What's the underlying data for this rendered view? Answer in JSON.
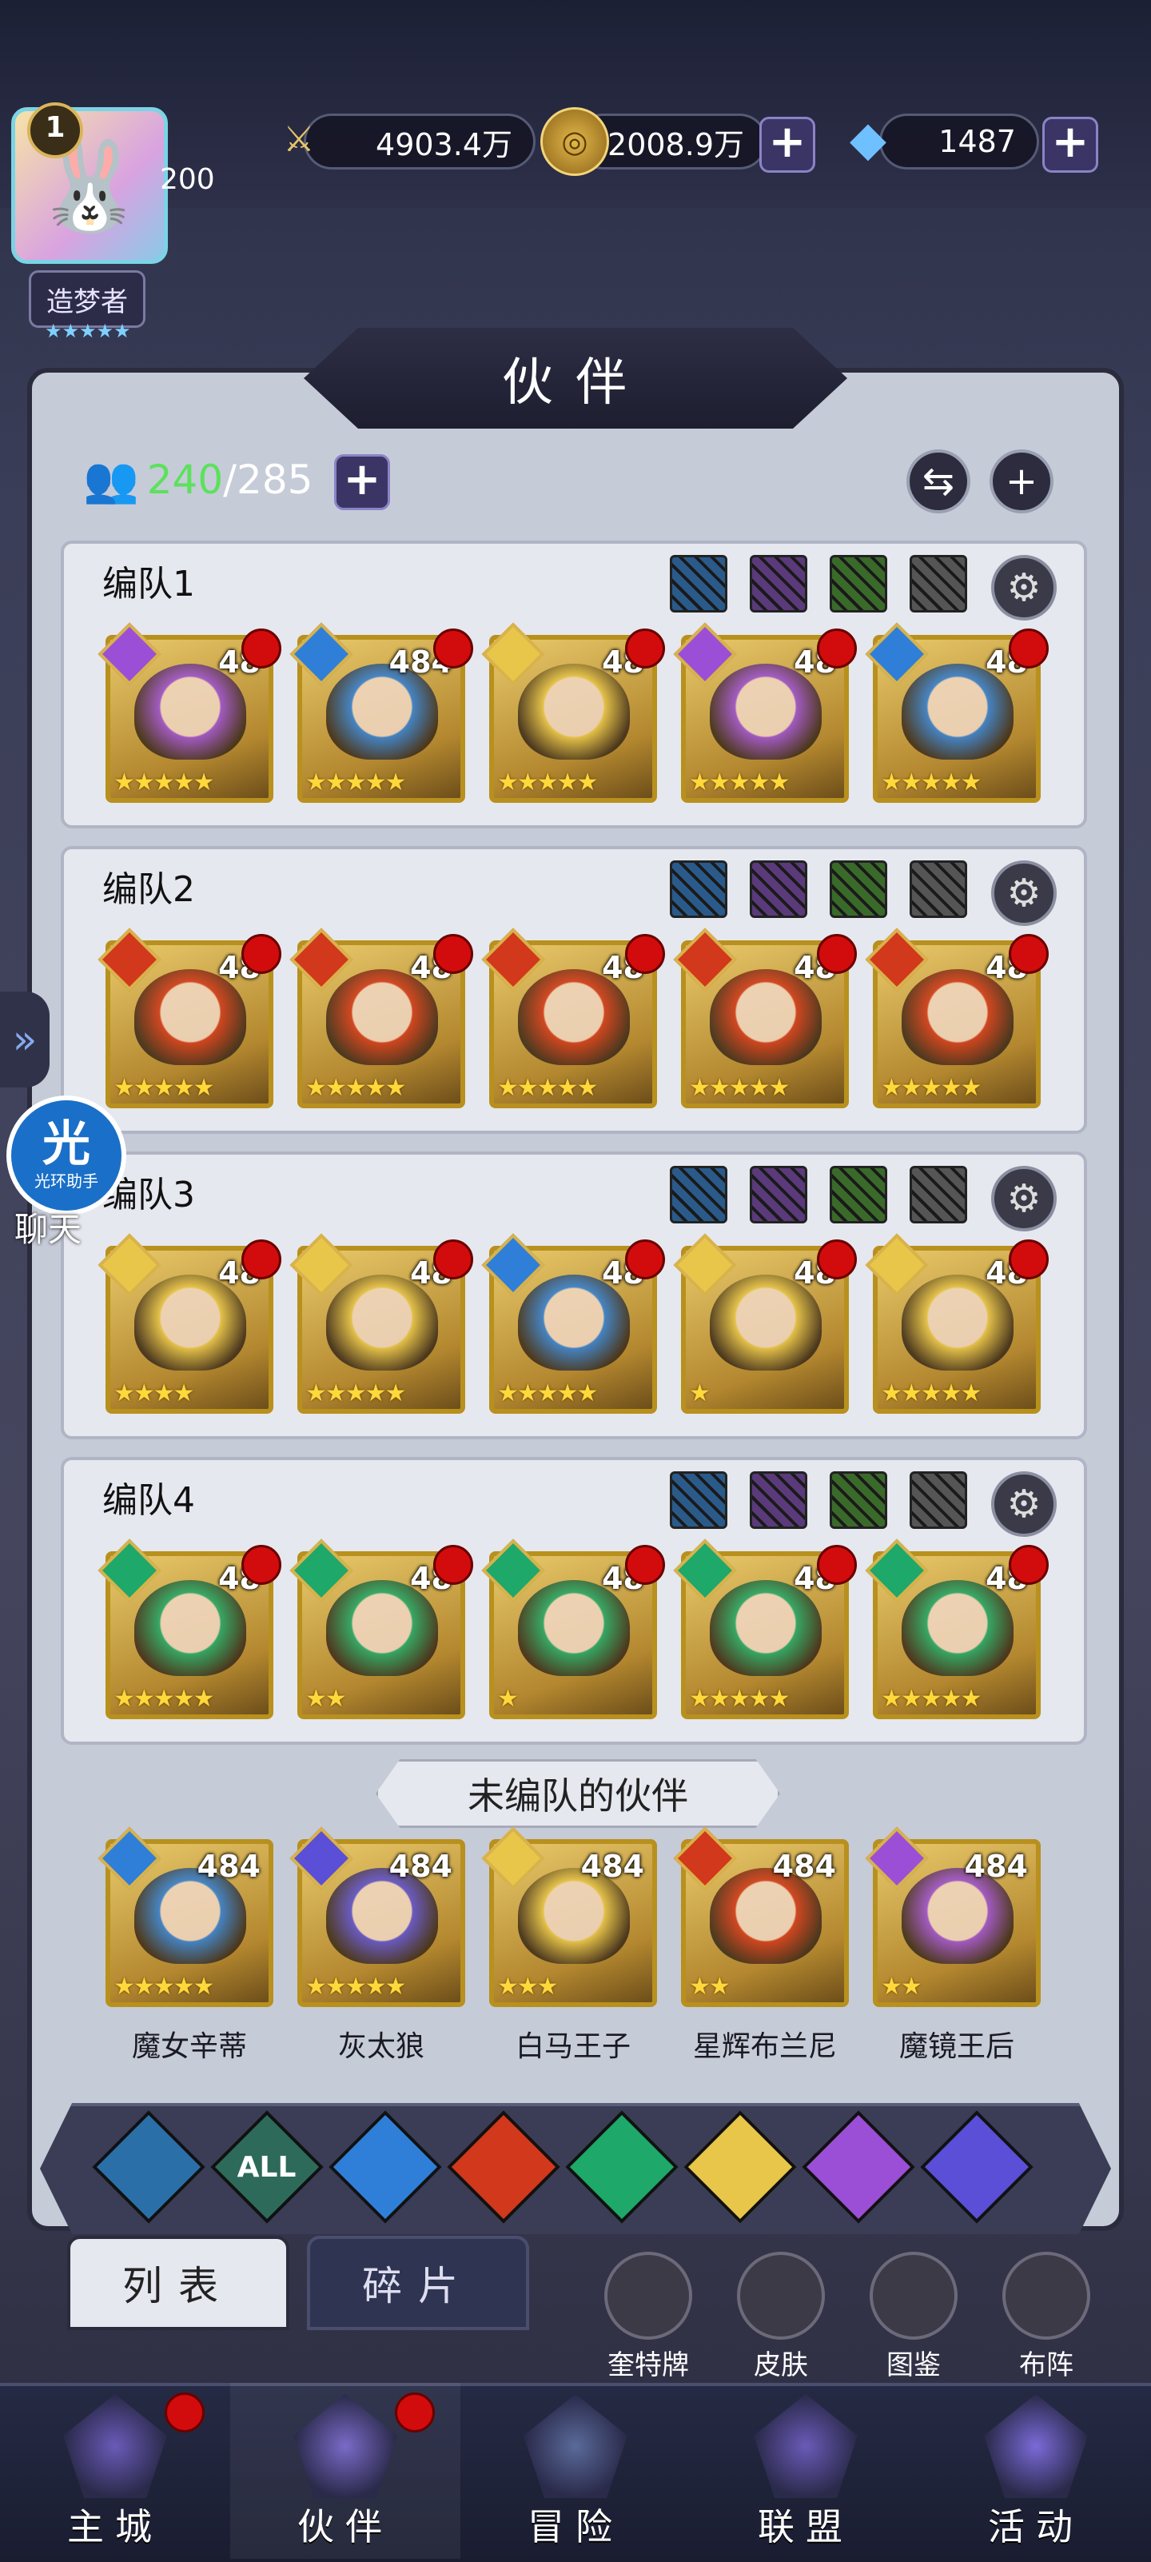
{
  "player": {
    "level": "1",
    "exp": "200",
    "rank": "造梦者",
    "rank_stars": "★★★★★"
  },
  "resources": {
    "power": "4903.4万",
    "gold": "2008.9万",
    "gems": "1487"
  },
  "panel": {
    "title": "伙伴",
    "count_current": "240",
    "count_total": "/285"
  },
  "teams": [
    {
      "name": "编队1",
      "heroes": [
        {
          "level": "48",
          "stars": "★★★★★",
          "element": "moon"
        },
        {
          "level": "484",
          "stars": "★★★★★",
          "element": "water"
        },
        {
          "level": "48",
          "stars": "★★★★★",
          "element": "light"
        },
        {
          "level": "48",
          "stars": "★★★★★",
          "element": "moon"
        },
        {
          "level": "48",
          "stars": "★★★★★",
          "element": "water"
        }
      ]
    },
    {
      "name": "编队2",
      "heroes": [
        {
          "level": "48",
          "stars": "★★★★★",
          "element": "fire"
        },
        {
          "level": "48",
          "stars": "★★★★★",
          "element": "fire"
        },
        {
          "level": "48",
          "stars": "★★★★★",
          "element": "fire"
        },
        {
          "level": "48",
          "stars": "★★★★★",
          "element": "fire"
        },
        {
          "level": "48",
          "stars": "★★★★★",
          "element": "fire"
        }
      ]
    },
    {
      "name": "编队3",
      "heroes": [
        {
          "level": "48",
          "stars": "★★★★",
          "element": "light"
        },
        {
          "level": "48",
          "stars": "★★★★★",
          "element": "light"
        },
        {
          "level": "48",
          "stars": "★★★★★",
          "element": "water"
        },
        {
          "level": "48",
          "stars": "★",
          "element": "light"
        },
        {
          "level": "48",
          "stars": "★★★★★",
          "element": "light"
        }
      ]
    },
    {
      "name": "编队4",
      "heroes": [
        {
          "level": "48",
          "stars": "★★★★★",
          "element": "wind"
        },
        {
          "level": "48",
          "stars": "★★",
          "element": "wind"
        },
        {
          "level": "48",
          "stars": "★",
          "element": "wind"
        },
        {
          "level": "48",
          "stars": "★★★★★",
          "element": "wind"
        },
        {
          "level": "48",
          "stars": "★★★★★",
          "element": "wind"
        }
      ]
    }
  ],
  "unassigned_label": "未编队的伙伴",
  "unassigned": [
    {
      "name": "魔女辛蒂",
      "level": "484",
      "stars": "★★★★★",
      "element": "water"
    },
    {
      "name": "灰太狼",
      "level": "484",
      "stars": "★★★★★",
      "element": "cosmic"
    },
    {
      "name": "白马王子",
      "level": "484",
      "stars": "★★★",
      "element": "light"
    },
    {
      "name": "星辉布兰尼",
      "level": "484",
      "stars": "★★",
      "element": "fire"
    },
    {
      "name": "魔镜王后",
      "level": "484",
      "stars": "★★",
      "element": "moon"
    }
  ],
  "filters": [
    {
      "name": "blue",
      "label": ""
    },
    {
      "name": "all",
      "label": "ALL"
    },
    {
      "name": "water",
      "label": ""
    },
    {
      "name": "fire",
      "label": ""
    },
    {
      "name": "wind",
      "label": ""
    },
    {
      "name": "light",
      "label": ""
    },
    {
      "name": "moon",
      "label": ""
    },
    {
      "name": "cosmic",
      "label": ""
    }
  ],
  "tabs": {
    "list": "列表",
    "fragments": "碎片"
  },
  "quick_actions": [
    "奎特牌",
    "皮肤",
    "图鉴",
    "布阵"
  ],
  "nav": [
    "主城",
    "伙伴",
    "冒险",
    "联盟",
    "活动"
  ],
  "side": {
    "helper": "光环助手",
    "helper_glyph": "光",
    "chat": "聊天"
  },
  "colors": {
    "water": "#2f7fd8",
    "fire": "#d2381b",
    "wind": "#1ea86a",
    "light": "#e8c64a",
    "moon": "#9b4fd6",
    "cosmic": "#5a4fd6",
    "blue": "#2b6fa8",
    "all": "#2e6a5a"
  }
}
